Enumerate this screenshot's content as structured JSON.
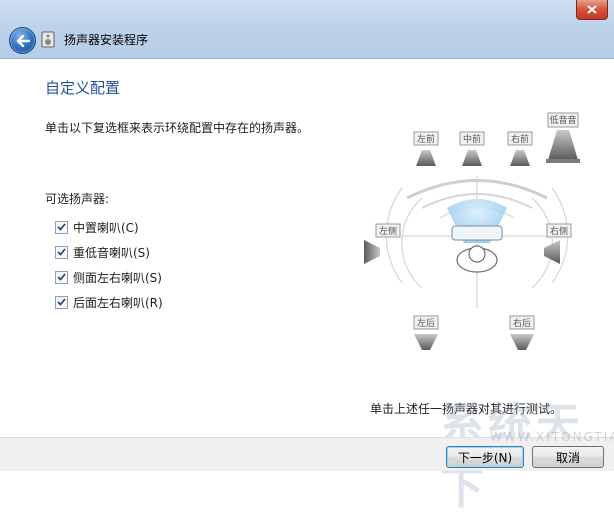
{
  "window": {
    "title": "扬声器安装程序"
  },
  "icons": {
    "back": "back-arrow-icon",
    "close": "close-x-icon",
    "app": "speaker-setup-icon"
  },
  "page": {
    "heading": "自定义配置",
    "instruction": "单击以下复选框来表示环绕配置中存在的扬声器。",
    "optional_label": "可选扬声器:",
    "options": [
      {
        "label": "中置喇叭(C)",
        "checked": true
      },
      {
        "label": "重低音喇叭(S)",
        "checked": true
      },
      {
        "label": "侧面左右喇叭(S)",
        "checked": true
      },
      {
        "label": "后面左右喇叭(R)",
        "checked": true
      }
    ],
    "test_instruction": "单击上述任一扬声器对其进行测试。"
  },
  "speakers": {
    "front_left": "左前",
    "center": "中前",
    "front_right": "右前",
    "subwoofer": "低音音",
    "side_left": "左侧",
    "side_right": "右侧",
    "rear_left": "左后",
    "rear_right": "右后"
  },
  "buttons": {
    "next": "下一步(N)",
    "cancel": "取消"
  },
  "watermark": {
    "main": "系统天下",
    "sub": "WWW.XITONGTIANXIA"
  }
}
